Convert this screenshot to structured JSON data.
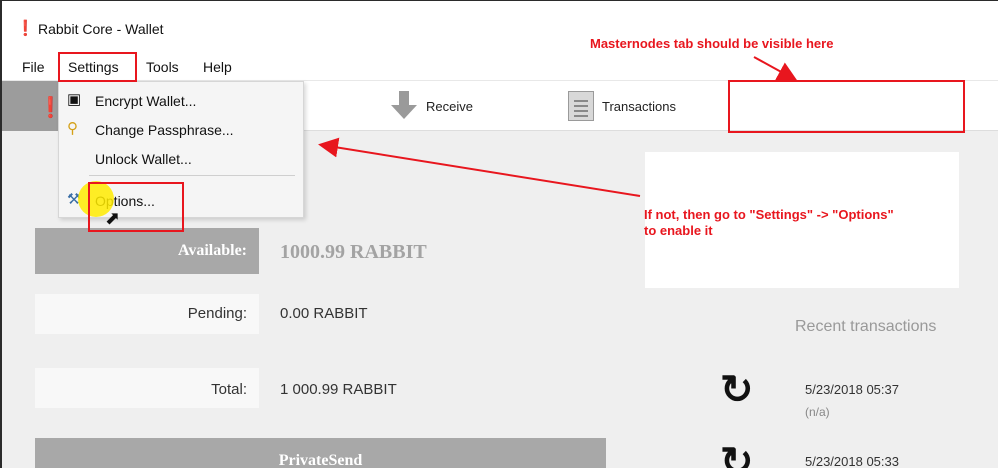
{
  "window": {
    "title": "Rabbit Core - Wallet"
  },
  "menubar": {
    "items": [
      "File",
      "Settings",
      "Tools",
      "Help"
    ]
  },
  "toolbar": {
    "receive_label": "Receive",
    "transactions_label": "Transactions"
  },
  "settings_menu": {
    "items": [
      {
        "label": "Encrypt Wallet...",
        "icon": "lock-icon"
      },
      {
        "label": "Change Passphrase...",
        "icon": "key-icon"
      },
      {
        "label": "Unlock Wallet...",
        "icon": ""
      },
      {
        "label": "Options...",
        "icon": "wrench-icon"
      }
    ]
  },
  "balances": {
    "available_label": "Available:",
    "available_value": "1000.99 RABBIT",
    "pending_label": "Pending:",
    "pending_value": "0.00 RABBIT",
    "total_label": "Total:",
    "total_value": "1 000.99 RABBIT"
  },
  "privatesend": {
    "title": "PrivateSend"
  },
  "recent": {
    "title": "Recent transactions",
    "items": [
      {
        "date": "5/23/2018 05:37",
        "sub": "(n/a)"
      },
      {
        "date": "5/23/2018 05:33",
        "sub": ""
      }
    ]
  },
  "annotations": {
    "masternodes_note": "Masternodes tab should be visible here",
    "options_note_line1": "If not, then go to \"Settings\" -> \"Options\"",
    "options_note_line2": "to enable it",
    "color": "#e8161e"
  }
}
